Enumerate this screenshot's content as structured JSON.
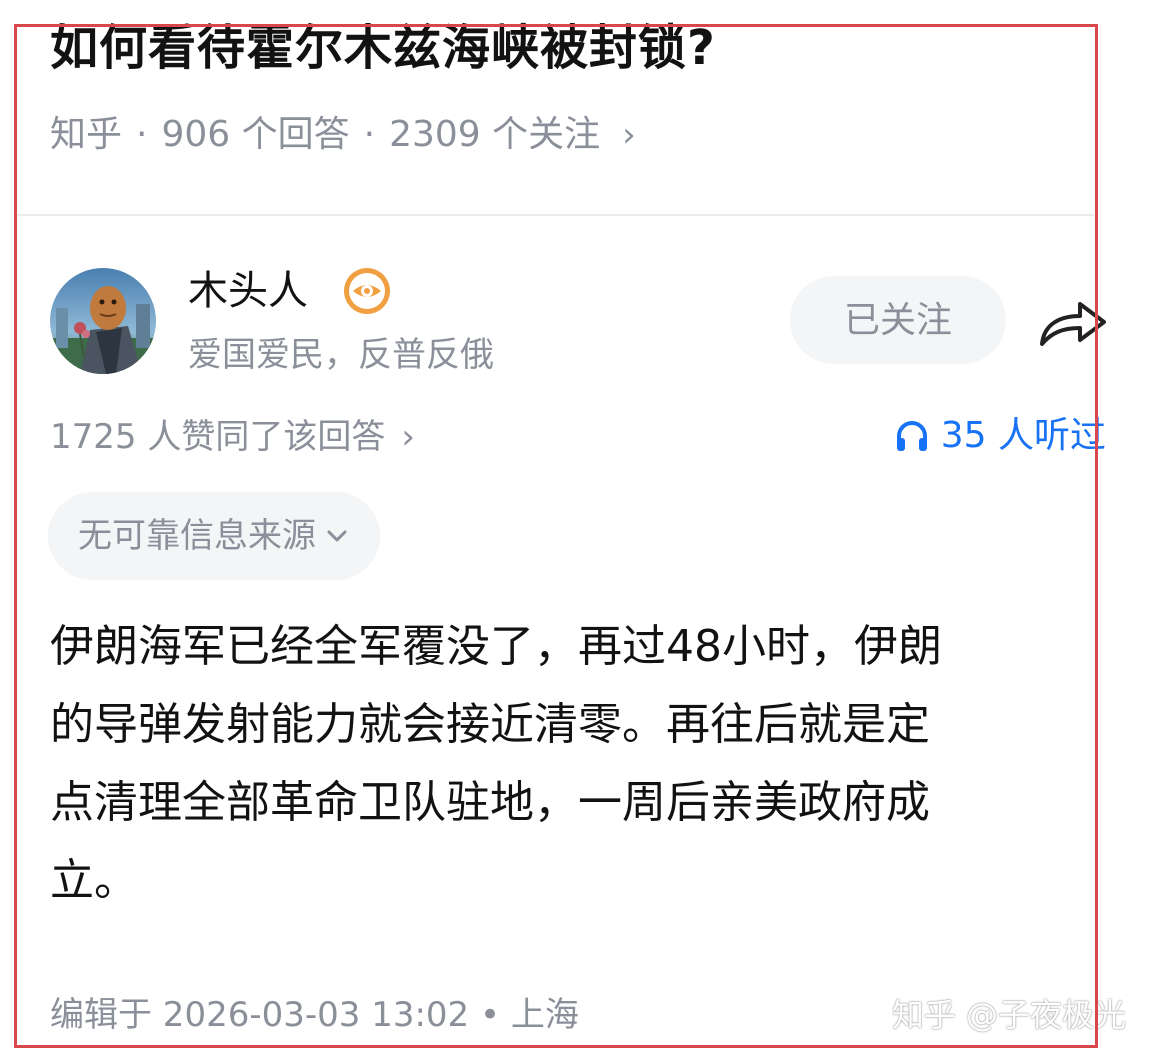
{
  "question": {
    "title": "如何看待霍尔木兹海峡被封锁?",
    "source": "知乎",
    "separator": "·",
    "answers": "906 个回答",
    "followers": "2309 个关注",
    "chevron": "›"
  },
  "author": {
    "name": "木头人",
    "bio": "爱国爱民，反普反俄",
    "follow_label": "已关注",
    "icons": {
      "avatar": "avatar-icon",
      "badge": "eye-badge-icon",
      "share": "share-icon"
    }
  },
  "stats": {
    "likes": "1725 人赞同了该回答",
    "chevron": "›",
    "listen": "35 人听过",
    "listen_icon": "headphones-icon"
  },
  "source_chip": {
    "label": "无可靠信息来源",
    "icon": "chevron-down-icon"
  },
  "content": {
    "lines": [
      "伊朗海军已经全军覆没了，再过48小时，伊朗",
      "的导弹发射能力就会接近清零。再往后就是定",
      "点清理全部革命卫队驻地，一周后亲美政府成",
      "立。"
    ]
  },
  "footer": {
    "edited": "编辑于 2026-03-03 13:02 • 上海",
    "watermark": "知乎 @子夜极光"
  },
  "colors": {
    "accent_blue": "#1772f6",
    "muted_text": "#8a8f99",
    "chip_bg": "#f4f5f7",
    "highlight_border": "#d9464c",
    "badge_orange": "#f0a040"
  }
}
